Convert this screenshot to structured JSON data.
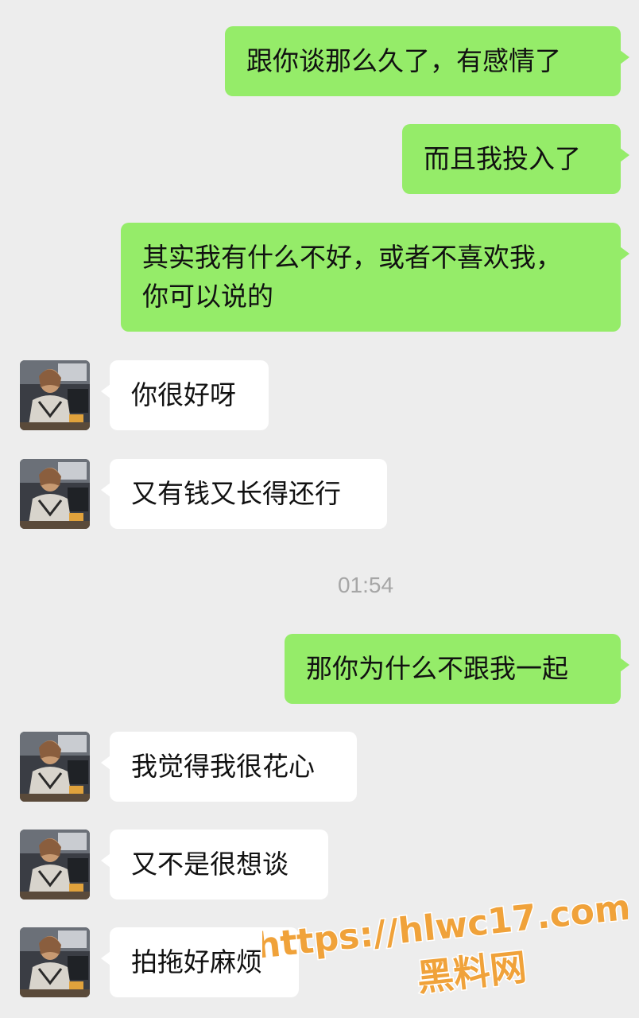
{
  "messages": [
    {
      "side": "out",
      "text": "跟你谈那么久了，有感情了"
    },
    {
      "side": "out",
      "text": "而且我投入了"
    },
    {
      "side": "out",
      "text": "其实我有什么不好，或者不喜欢我，\n你可以说的"
    },
    {
      "side": "in",
      "text": "你很好呀"
    },
    {
      "side": "in",
      "text": "又有钱又长得还行"
    },
    {
      "side": "out",
      "text": "那你为什么不跟我一起"
    },
    {
      "side": "in",
      "text": "我觉得我很花心"
    },
    {
      "side": "in",
      "text": "又不是很想谈"
    },
    {
      "side": "in",
      "text": "拍拖好麻烦"
    }
  ],
  "timestamp": "01:54",
  "watermark": {
    "url": "https://hlwc17.com",
    "site": "黑料网"
  },
  "colors": {
    "background": "#ededed",
    "outgoing_bubble": "#95ec69",
    "incoming_bubble": "#ffffff",
    "watermark_fill": "#f0a23a",
    "watermark_stroke": "#ffffff"
  }
}
